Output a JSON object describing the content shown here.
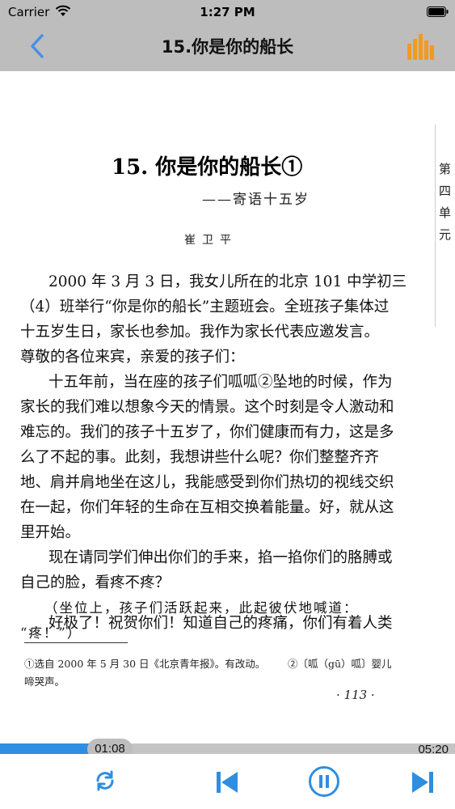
{
  "status_bar": {
    "carrier": "Carrier",
    "time": "1:27 PM"
  },
  "nav": {
    "title": "15.你是你的船长"
  },
  "page": {
    "side_label": "第四单元",
    "chapter_title": "15. 你是你的船长①",
    "chapter_subtitle": "——寄语十五岁",
    "author": "崔卫平",
    "lines": [
      "2000 年 3 月 3 日，我女儿所在的北京 101 中学初三",
      "（4）班举行“你是你的船长”主题班会。全班孩子集体过",
      "十五岁生日，家长也参加。我作为家长代表应邀发言。",
      "尊敬的各位来宾，亲爱的孩子们：",
      "十五年前，当在座的孩子们呱呱②坠地的时候，作为",
      "家长的我们难以想象今天的情景。这个时刻是令人激动和",
      "难忘的。我们的孩子十五岁了，你们健康而有力，这是多",
      "么了不起的事。此刻，我想讲些什么呢？你们整整齐齐",
      "地、肩并肩地坐在这儿，我能感受到你们热切的视线交织",
      "在一起，你们年轻的生命在互相交换着能量。好，就从这",
      "里开始。",
      "现在请同学们伸出你们的手来，掐一掐你们的胳膊或",
      "自己的脸，看疼不疼？",
      "（坐位上，孩子们活跃起来，此起彼伏地喊道：",
      "“疼！”）",
      "好极了！祝贺你们！知道自己的疼痛，你们有着人类"
    ],
    "footnote_1": "①选自 2000 年 5 月 30 日《北京青年报》。有改动。",
    "footnote_2": "②〔呱（gū）呱〕婴儿",
    "footnote_2_cont": "啼哭声。",
    "page_number": "· 113 ·"
  },
  "player": {
    "current_time": "01:08",
    "total_time": "05:20",
    "progress": 0.2125,
    "accent_color": "#2f8ee0",
    "icons": [
      "back-chevron-icon",
      "bar-chart-icon",
      "repeat-icon",
      "previous-track-icon",
      "pause-icon",
      "next-track-icon"
    ]
  }
}
